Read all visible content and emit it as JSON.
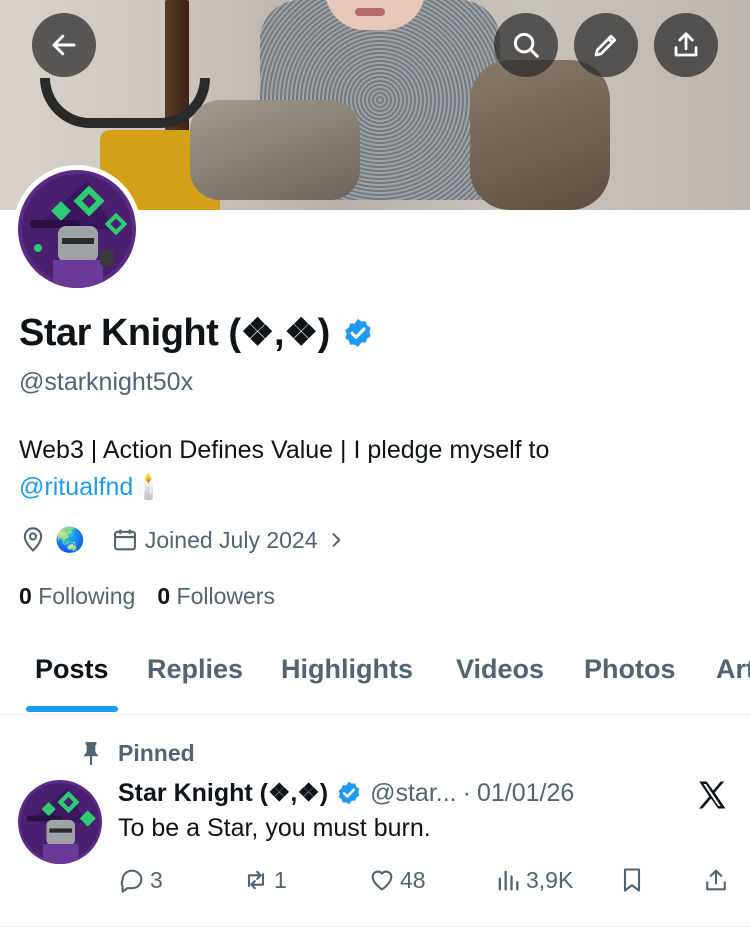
{
  "header": {
    "back_icon": "arrow-left-icon",
    "search_icon": "search-icon",
    "edit_icon": "pencil-icon",
    "share_icon": "share-icon",
    "button_bg": "#2b2b2b"
  },
  "profile": {
    "name": "Star Knight (❖,❖)",
    "handle": "@starknight50x",
    "bio_text": "Web3 | Action Defines Value | I pledge myself to",
    "bio_mention": "@ritualfnd",
    "bio_emoji": "🕯️",
    "location_emoji": "🌏",
    "joined": "Joined July 2024",
    "following_count": "0",
    "following_label": "Following",
    "followers_count": "0",
    "followers_label": "Followers"
  },
  "tabs": [
    {
      "label": "Posts"
    },
    {
      "label": "Replies"
    },
    {
      "label": "Highlights"
    },
    {
      "label": "Videos"
    },
    {
      "label": "Photos"
    },
    {
      "label": "Art"
    }
  ],
  "post": {
    "pinned_label": "Pinned",
    "author": "Star Knight (❖,❖)",
    "handle": "@star...",
    "separator": "·",
    "date": "01/01/26",
    "text": "To be a Star, you must burn.",
    "replies": "3",
    "reposts": "1",
    "likes": "48",
    "views": "3,9K"
  },
  "colors": {
    "accent": "#1d9bf0",
    "text": "#0f1419",
    "muted": "#536471",
    "avatar_bg": "#5b2a86",
    "avatar_green": "#2ecc71"
  }
}
